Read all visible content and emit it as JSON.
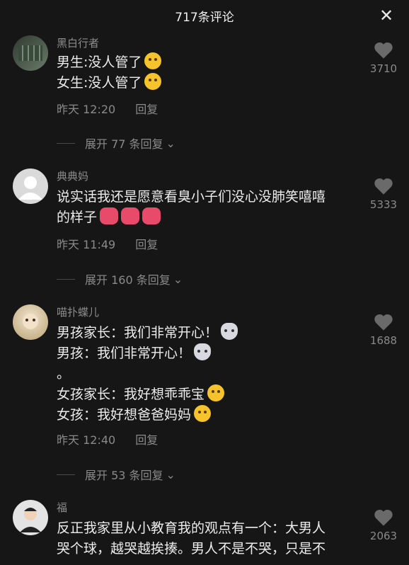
{
  "header": {
    "title": "717条评论",
    "close_icon": "✕"
  },
  "comments": [
    {
      "user": "黑白行者",
      "lines": [
        "男生:没人管了",
        "女生:没人管了"
      ],
      "time": "昨天 12:20",
      "reply_label": "回复",
      "likes": "3710",
      "expand_label": "展开 77 条回复",
      "avatar_color": "#4a5a4a"
    },
    {
      "user": "典典妈",
      "lines": [
        "说实话我还是愿意看臭小子们没心没肺笑嘻嘻",
        "的样子"
      ],
      "time": "昨天 11:49",
      "reply_label": "回复",
      "likes": "5333",
      "expand_label": "展开 160 条回复",
      "avatar_color": "#d8d8d8"
    },
    {
      "user": "喵扑蝶儿",
      "lines": [
        "男孩家长：我们非常开心！",
        "男孩：我们非常开心！",
        "。",
        "女孩家长：我好想乖乖宝",
        "女孩：我好想爸爸妈妈"
      ],
      "time": "昨天 12:40",
      "reply_label": "回复",
      "likes": "1688",
      "expand_label": "展开 53 条回复",
      "avatar_color": "#c8b89a"
    },
    {
      "user": "福",
      "lines": [
        "反正我家里从小教育我的观点有一个：大男人",
        "哭个球，越哭越挨揍。男人不是不哭，只是不"
      ],
      "likes": "2063",
      "avatar_color": "#e0e0e0"
    }
  ]
}
